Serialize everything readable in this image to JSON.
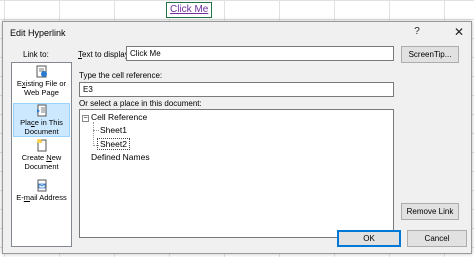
{
  "sheet": {
    "cell_text": "Click Me"
  },
  "dialog": {
    "title": "Edit Hyperlink",
    "help_glyph": "?",
    "close_glyph": "✕",
    "link_to_label": "Link to:",
    "link_to": [
      {
        "pre": "E",
        "ul": "x",
        "post": "isting File or Web Page",
        "icon": "file-web-icon",
        "selected": false
      },
      {
        "pre": "Pla",
        "ul": "c",
        "post": "e in This Document",
        "icon": "place-in-document-icon",
        "selected": true
      },
      {
        "pre": "Create ",
        "ul": "N",
        "post": "ew Document",
        "icon": "new-document-icon",
        "selected": false
      },
      {
        "pre": "E-",
        "ul": "m",
        "post": "ail Address",
        "icon": "email-icon",
        "selected": false
      }
    ],
    "text_to_display": {
      "pre": "",
      "ul": "T",
      "post": "ext to display:",
      "value": "Click Me"
    },
    "screentip_button": "ScreenTip...",
    "cell_reference": {
      "label": "Type the cell reference:",
      "value": "E3"
    },
    "place_label": "Or select a place in this document:",
    "tree": {
      "root": "Cell Reference",
      "children": [
        "Sheet1",
        "Sheet2"
      ],
      "selected": "Sheet2",
      "other": "Defined Names",
      "expander": "−"
    },
    "remove_link_button": "Remove Link",
    "ok_button": "OK",
    "cancel_button": "Cancel"
  }
}
